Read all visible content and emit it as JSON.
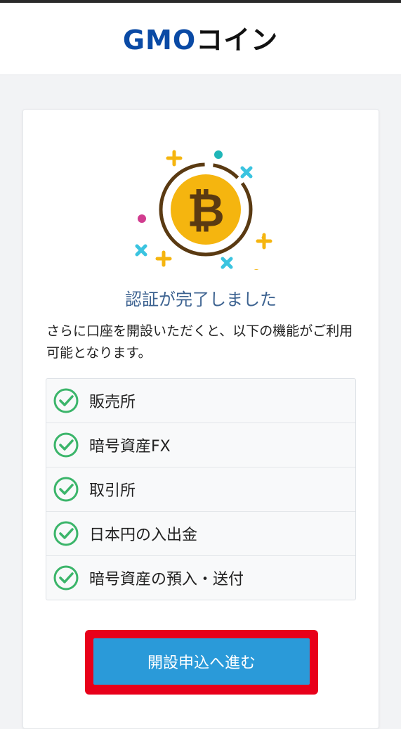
{
  "header": {
    "logo_gmo": "GMO",
    "logo_coin": "コイン"
  },
  "card": {
    "title": "認証が完了しました",
    "description": "さらに口座を開設いただくと、以下の機能がご利用可能となります。",
    "features": [
      {
        "label": "販売所",
        "icon": "check-circle-icon"
      },
      {
        "label": "暗号資産FX",
        "icon": "check-circle-icon"
      },
      {
        "label": "取引所",
        "icon": "check-circle-icon"
      },
      {
        "label": "日本円の入出金",
        "icon": "check-circle-icon"
      },
      {
        "label": "暗号資産の預入・送付",
        "icon": "check-circle-icon"
      }
    ],
    "cta_label": "開設申込へ進む"
  },
  "colors": {
    "brand_blue": "#0a4aa5",
    "title_blue": "#3c6290",
    "check_green": "#3bb56a",
    "button_blue": "#2a9ad9",
    "highlight_red": "#e8001a",
    "coin_gold": "#f5b50f"
  }
}
